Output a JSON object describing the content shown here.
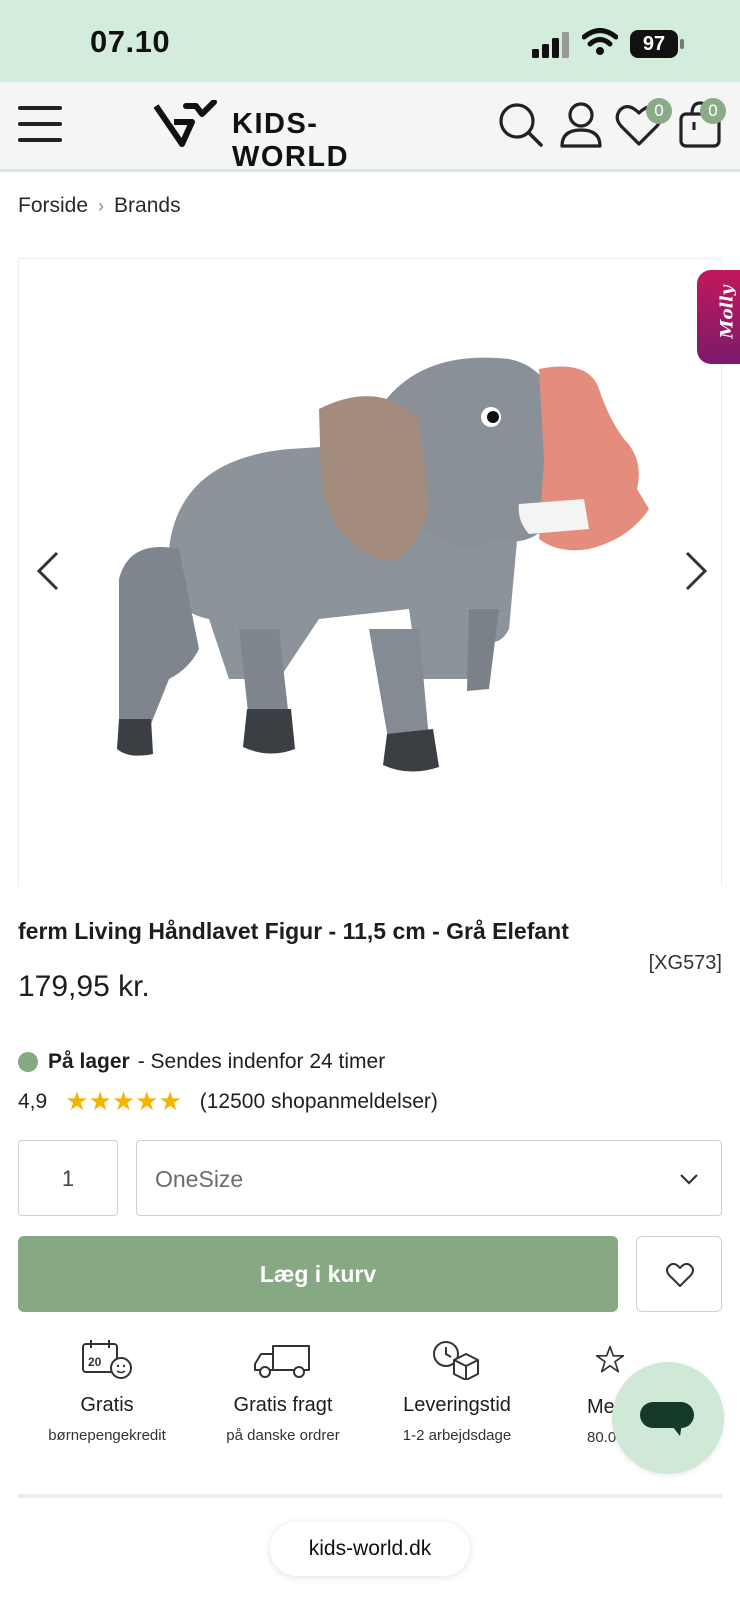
{
  "status_bar": {
    "time": "07.10",
    "battery": "97"
  },
  "header": {
    "logo_text": "KIDS-WORLD",
    "wishlist_count": "0",
    "cart_count": "0",
    "icons": [
      "menu-icon",
      "search-icon",
      "user-icon",
      "heart-icon",
      "bag-icon"
    ]
  },
  "breadcrumb": [
    "Forside",
    "Brands"
  ],
  "gallery": {
    "image_alt": "Grå træelefant",
    "badge": "Molly"
  },
  "product": {
    "title": "ferm Living Håndlavet Figur - 11,5 cm - Grå Elefant",
    "sku": "[XG573]",
    "price": "179,95 kr.",
    "stock_status": "På lager",
    "stock_note": "- Sendes indenfor 24 timer",
    "rating_value": "4,9",
    "rating_stars": 5,
    "rating_count": "(12500 shopanmeldelser)",
    "quantity": "1",
    "size_selected": "OneSize",
    "add_to_cart": "Læg i kurv"
  },
  "usps": [
    {
      "title": "Gratis",
      "subtitle": "børnepengekredit",
      "icon": "calendar-icon"
    },
    {
      "title": "Gratis fragt",
      "subtitle": "på danske ordrer",
      "icon": "truck-icon"
    },
    {
      "title": "Leveringstid",
      "subtitle": "1-2 arbejdsdage",
      "icon": "clock-box-icon"
    },
    {
      "title": "Me",
      "subtitle": "80.0",
      "icon": "star-icon"
    }
  ],
  "colors": {
    "accent": "#86a883",
    "status_bar_bg": "#d3ecdc",
    "star": "#f5b400",
    "badge": "#c2185b"
  },
  "footer": {
    "url": "kids-world.dk"
  }
}
